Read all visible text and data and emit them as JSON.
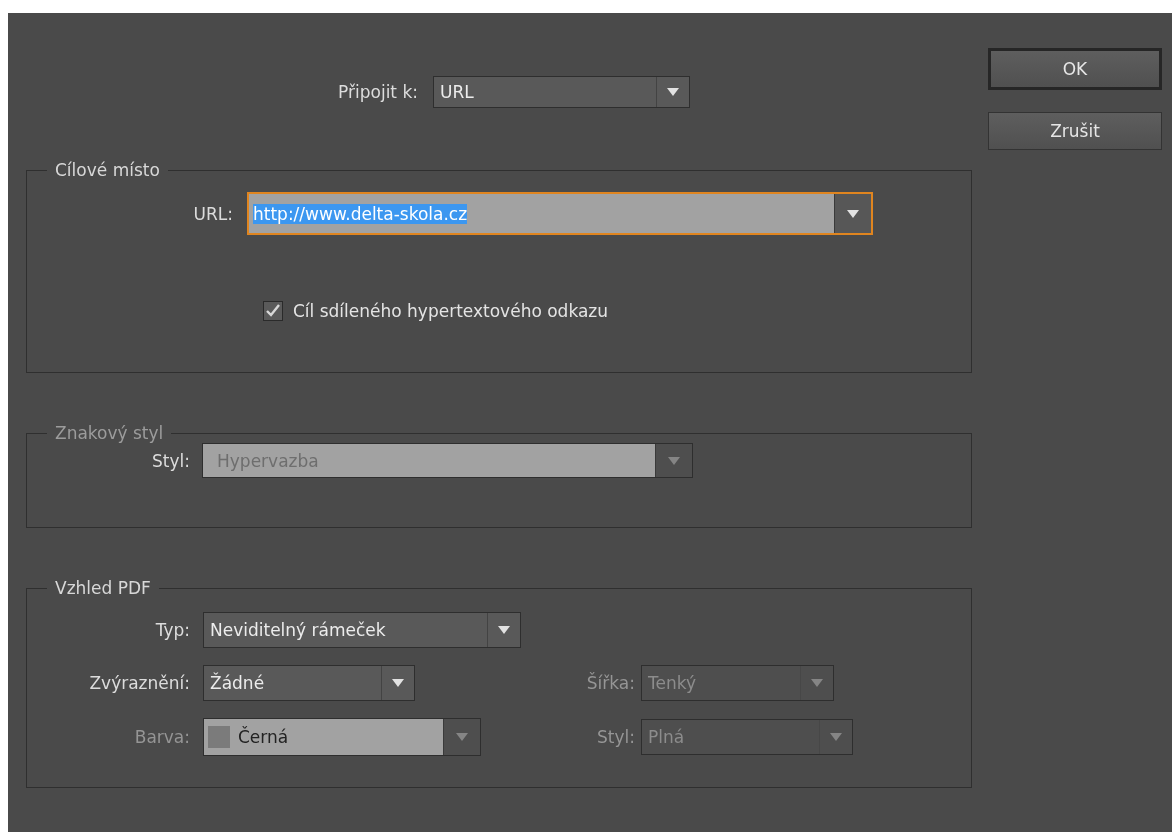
{
  "link_to": {
    "label": "Připojit k:",
    "value": "URL"
  },
  "buttons": [
    {
      "label": "OK",
      "default": true
    },
    {
      "label": "Zrušit",
      "default": false
    }
  ],
  "destination": {
    "title": "Cílové místo",
    "url": {
      "label": "URL:",
      "value": "http://www.delta-skola.cz",
      "focused": true,
      "selected": true
    },
    "shared": {
      "label": "Cíl sdíleného hypertextového odkazu",
      "checked": true
    }
  },
  "character_style": {
    "title": "Znakový styl",
    "disabled": true,
    "style": {
      "label": "Styl:",
      "value": "Hypervazba"
    }
  },
  "pdf_appearance": {
    "title": "Vzhled PDF",
    "rows": [
      [
        {
          "kind": "select",
          "label": "Typ:",
          "value": "Neviditelný rámeček",
          "disabled": false
        }
      ],
      [
        {
          "kind": "select",
          "label": "Zvýraznění:",
          "value": "Žádné",
          "disabled": false
        },
        {
          "kind": "select",
          "label": "Šířka:",
          "value": "Tenký",
          "disabled": true
        }
      ],
      [
        {
          "kind": "color",
          "label": "Barva:",
          "value": "Černá",
          "disabled": true
        },
        {
          "kind": "select",
          "label": "Styl:",
          "value": "Plná",
          "disabled": true
        }
      ]
    ]
  }
}
